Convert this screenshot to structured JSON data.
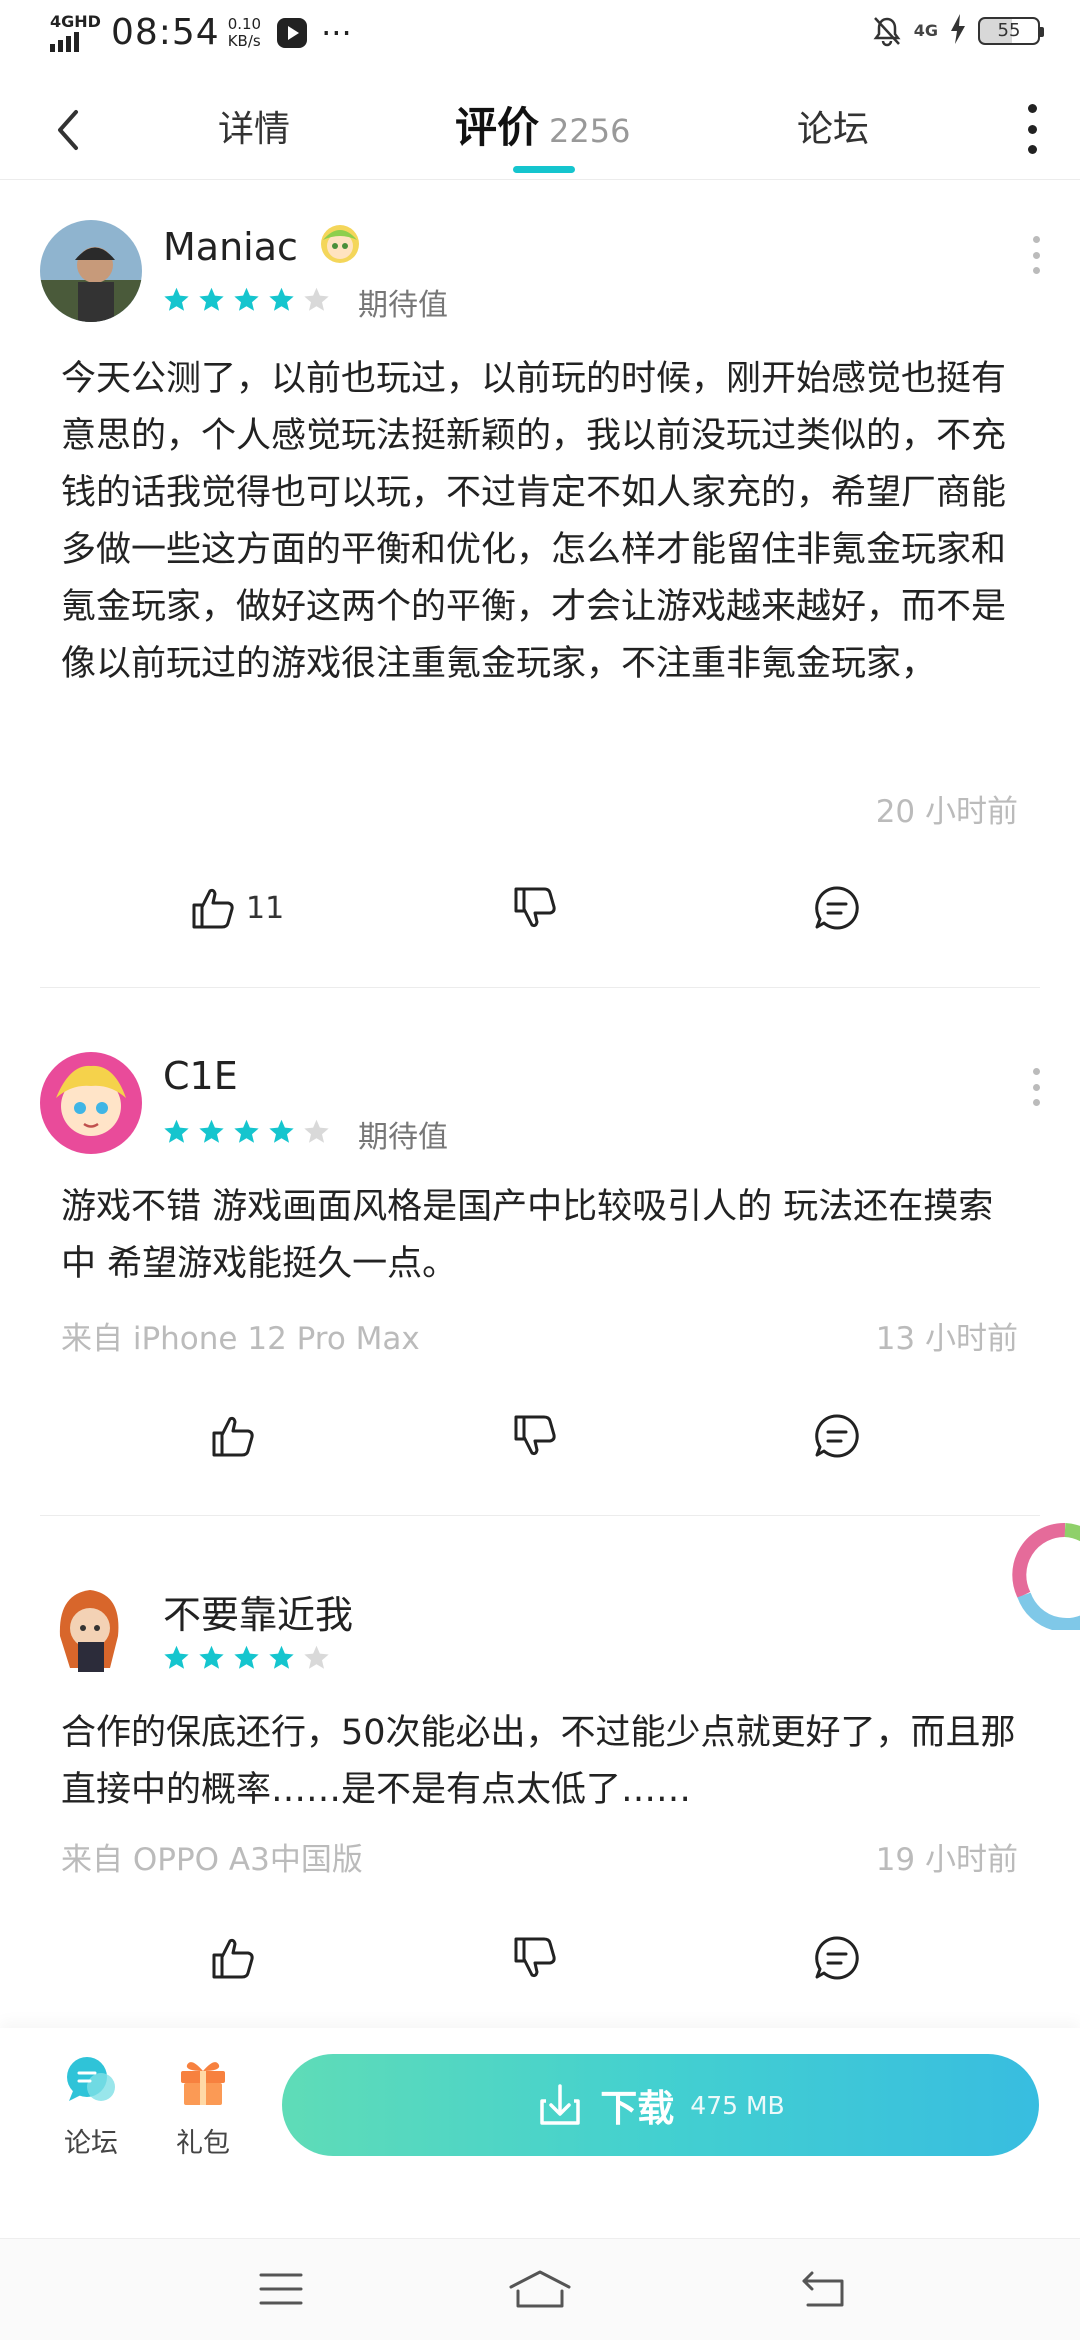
{
  "status_bar": {
    "network": "4GHD",
    "time": "08:54",
    "speed_value": "0.10",
    "speed_unit": "KB/s",
    "more": "···",
    "net_right": "4G",
    "battery": "55"
  },
  "header": {
    "tabs": [
      {
        "label": "详情"
      },
      {
        "label": "评价",
        "count": "2256"
      },
      {
        "label": "论坛"
      }
    ]
  },
  "reviews": [
    {
      "username": "Maniac",
      "rating": 4,
      "max_rating": 5,
      "tag": "期待值",
      "content": "今天公测了，以前也玩过，以前玩的时候，刚开始感觉也挺有意思的，个人感觉玩法挺新颖的，我以前没玩过类似的，不充钱的话我觉得也可以玩，不过肯定不如人家充的，希望厂商能多做一些这方面的平衡和优化，怎么样才能留住非氪金玩家和氪金玩家，做好这两个的平衡，才会让游戏越来越好，而不是像以前玩过的游戏很注重氪金玩家，不注重非氪金玩家，",
      "device": "",
      "time": "20 小时前",
      "likes": "11"
    },
    {
      "username": "C1E",
      "rating": 4,
      "max_rating": 5,
      "tag": "期待值",
      "content": "游戏不错 游戏画面风格是国产中比较吸引人的 玩法还在摸索中 希望游戏能挺久一点。",
      "device": "来自 iPhone 12 Pro Max",
      "time": "13 小时前",
      "likes": ""
    },
    {
      "username": "不要靠近我",
      "rating": 4,
      "max_rating": 5,
      "tag": "",
      "content": "合作的保底还行，50次能必出，不过能少点就更好了，而且那直接中的概率……是不是有点太低了……",
      "device": "来自 OPPO A3中国版",
      "time": "19 小时前",
      "likes": ""
    }
  ],
  "bottom_bar": {
    "forum_label": "论坛",
    "gift_label": "礼包",
    "download_label": "下载",
    "download_size": "475 MB"
  },
  "colors": {
    "accent": "#15c5ce",
    "star_on": "#15c5ce",
    "star_off": "#d9d9d9",
    "muted_text": "#bbbbbb"
  },
  "icons": [
    "back-arrow-icon",
    "more-vertical-icon",
    "star-icon",
    "thumbs-up-icon",
    "thumbs-down-icon",
    "comment-icon",
    "forum-chat-icon",
    "gift-icon",
    "download-icon",
    "menu-icon",
    "home-icon",
    "back-icon"
  ]
}
